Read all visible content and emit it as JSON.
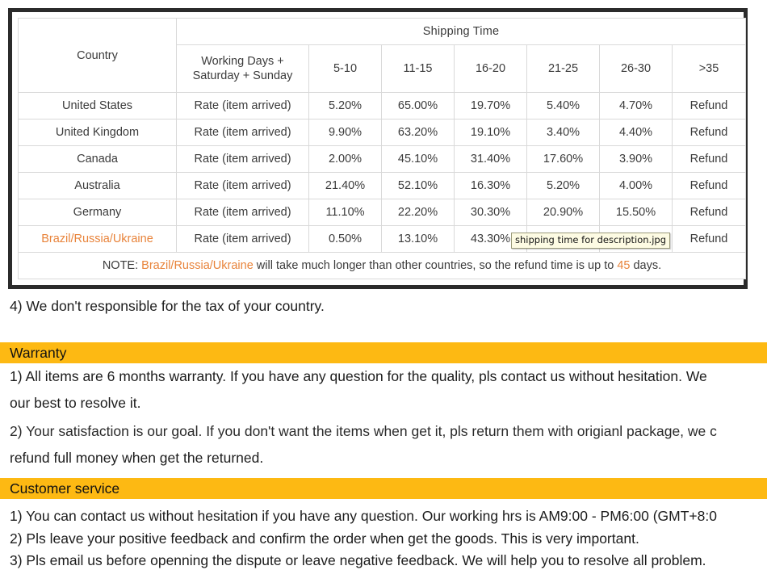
{
  "shipping_table": {
    "country_header": "Country",
    "shipping_time_header": "Shipping Time",
    "rate_column_header": "Working Days +\nSaturday + Sunday",
    "rate_column_header_line1": "Working Days +",
    "rate_column_header_line2": "Saturday + Sunday",
    "time_buckets": [
      "5-10",
      "11-15",
      "16-20",
      "21-25",
      "26-30",
      ">35"
    ],
    "rows": [
      {
        "country": "United States",
        "accent": false,
        "rate_label": "Rate (item arrived)",
        "values": [
          "5.20%",
          "65.00%",
          "19.70%",
          "5.40%",
          "4.70%",
          "Refund"
        ]
      },
      {
        "country": "United Kingdom",
        "accent": false,
        "rate_label": "Rate (item arrived)",
        "values": [
          "9.90%",
          "63.20%",
          "19.10%",
          "3.40%",
          "4.40%",
          "Refund"
        ]
      },
      {
        "country": "Canada",
        "accent": false,
        "rate_label": "Rate (item arrived)",
        "values": [
          "2.00%",
          "45.10%",
          "31.40%",
          "17.60%",
          "3.90%",
          "Refund"
        ]
      },
      {
        "country": "Australia",
        "accent": false,
        "rate_label": "Rate (item arrived)",
        "values": [
          "21.40%",
          "52.10%",
          "16.30%",
          "5.20%",
          "4.00%",
          "Refund"
        ]
      },
      {
        "country": "Germany",
        "accent": false,
        "rate_label": "Rate (item arrived)",
        "values": [
          "11.10%",
          "22.20%",
          "30.30%",
          "20.90%",
          "15.50%",
          "Refund"
        ]
      },
      {
        "country": "Brazil/Russia/Ukraine",
        "accent": true,
        "rate_label": "Rate (item arrived)",
        "values": [
          "0.50%",
          "13.10%",
          "43.30%",
          "",
          "",
          "Refund"
        ]
      }
    ],
    "note": {
      "prefix": "NOTE: ",
      "accent_country": "Brazil/Russia/Ukraine",
      "middle": " will take much longer than other countries, so the refund time is up to ",
      "accent_days": "45",
      "suffix": " days."
    }
  },
  "tooltip": {
    "text": "shipping time for description.jpg"
  },
  "tax_note": "4) We don't responsible for the tax of your country.",
  "warranty": {
    "title": "Warranty",
    "lines": [
      "1) All items are 6 months warranty. If you have any question for the quality, pls contact us without hesitation. We",
      "our best to resolve it.",
      "2) Your satisfaction is our goal. If you don't want the items when get it, pls return them with origianl package, we c",
      "refund full money when get the returned."
    ]
  },
  "customer_service": {
    "title": "Customer service",
    "lines": [
      "1) You can contact us without hesitation if you have any question. Our working hrs is AM9:00 - PM6:00 (GMT+8:0",
      "2) Pls leave your positive feedback and confirm the order when get the goods. This is very important.",
      "3) Pls email us before openning the dispute or leave negative feedback. We will help you to resolve all problem."
    ]
  },
  "colors": {
    "banner_amber": "#fdb913",
    "accent_orange": "#e8833a",
    "frame_dark": "#2b2b2b",
    "tooltip_bg": "#fdfbe3"
  }
}
